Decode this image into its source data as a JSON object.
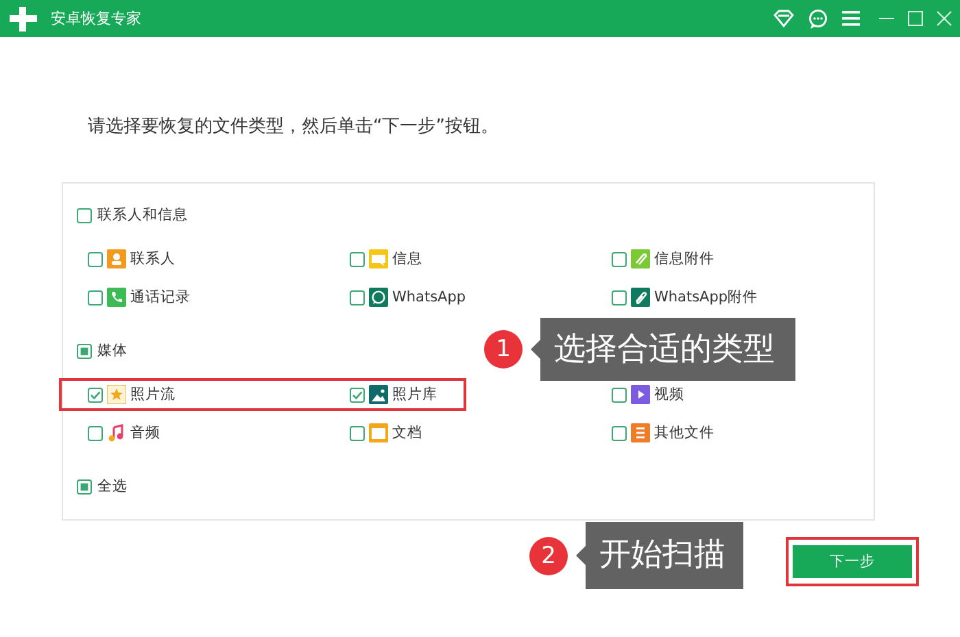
{
  "window": {
    "title": "安卓恢复专家"
  },
  "instruction": "请选择要恢复的文件类型，然后单击“下一步”按钮。",
  "groups": [
    {
      "label": "联系人和信息",
      "checked": false,
      "mixed": false,
      "rows": [
        {
          "items": [
            {
              "label": "联系人",
              "kind": "contacts",
              "checked": false
            },
            {
              "label": "信息",
              "kind": "messages",
              "checked": false
            },
            {
              "label": "信息附件",
              "kind": "attachment",
              "checked": false
            }
          ]
        },
        {
          "items": [
            {
              "label": "通话记录",
              "kind": "calls",
              "checked": false
            },
            {
              "label": "WhatsApp",
              "kind": "whatsapp",
              "checked": false
            },
            {
              "label": "WhatsApp附件",
              "kind": "whatsapp-attachment",
              "checked": false
            }
          ]
        }
      ]
    },
    {
      "label": "媒体",
      "checked": false,
      "mixed": true,
      "rows": [
        {
          "highlighted": true,
          "items": [
            {
              "label": "照片流",
              "kind": "photostream",
              "checked": true
            },
            {
              "label": "照片库",
              "kind": "gallery",
              "checked": true
            },
            {
              "label": "视频",
              "kind": "video",
              "checked": false
            }
          ]
        },
        {
          "items": [
            {
              "label": "音频",
              "kind": "audio",
              "checked": false
            },
            {
              "label": "文档",
              "kind": "document",
              "checked": false
            },
            {
              "label": "其他文件",
              "kind": "other",
              "checked": false
            }
          ]
        }
      ]
    },
    {
      "label": "全选",
      "checked": false,
      "mixed": true
    }
  ],
  "next_button": {
    "label": "下一步",
    "highlighted": true
  },
  "callouts": [
    {
      "number": "1",
      "text": "选择合适的类型"
    },
    {
      "number": "2",
      "text": "开始扫描"
    }
  ]
}
